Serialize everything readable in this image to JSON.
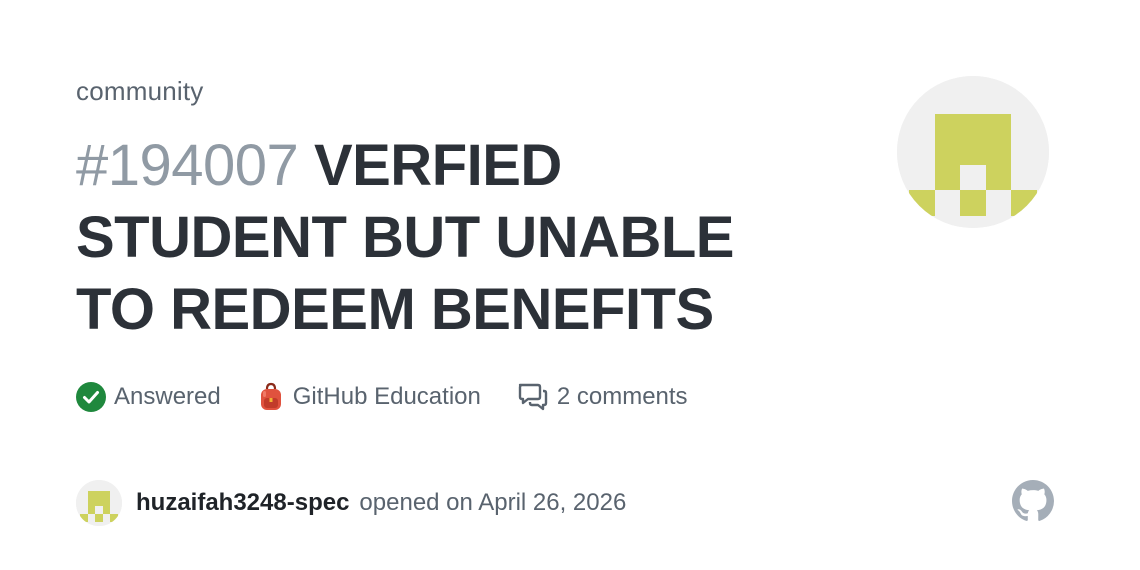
{
  "repo": "community",
  "discussion": {
    "number": "#194007",
    "title": "VERFIED STUDENT BUT UNABLE TO REDEEM BENEFITS"
  },
  "meta": {
    "status": "Answered",
    "category": "GitHub Education",
    "comments": "2 comments"
  },
  "footer": {
    "author": "huzaifah3248-spec",
    "opened_text": "opened on April 26, 2026"
  },
  "icons": {
    "answered": "check-circle-icon",
    "category": "backpack-icon",
    "comments": "comment-discussion-icon",
    "brand": "github-logo-icon"
  },
  "colors": {
    "answered_green": "#1f883d",
    "avatar_green": "#cdd25e",
    "number_gray": "#909aa4",
    "title_dark": "#2c3138",
    "muted_text": "#59636e"
  }
}
